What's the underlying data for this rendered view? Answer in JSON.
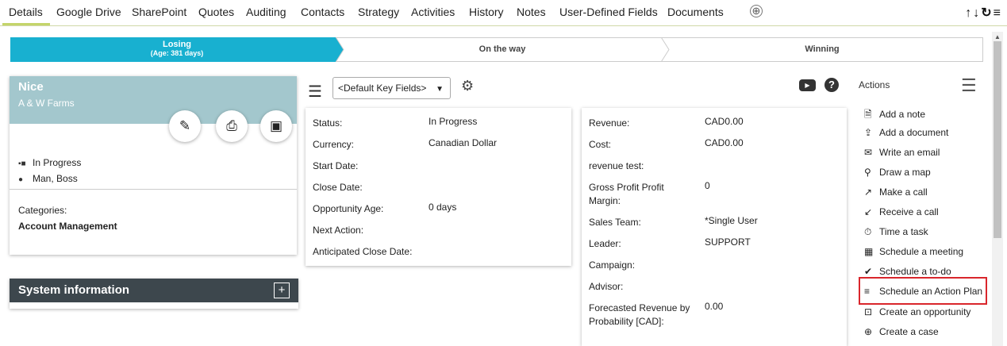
{
  "tabs": {
    "items": [
      "Details",
      "Google Drive",
      "SharePoint",
      "Quotes",
      "Auditing",
      "Contacts",
      "Strategy",
      "Activities",
      "History",
      "Notes",
      "User-Defined Fields",
      "Documents"
    ],
    "add": "⊕"
  },
  "top_icons": "↑↓↻≡",
  "stages": [
    {
      "label": "Losing",
      "sub": "(Age: 381 days)"
    },
    {
      "label": "On the way"
    },
    {
      "label": "Winning"
    }
  ],
  "card": {
    "title": "Nice",
    "subtitle": "A & W Farms",
    "status": "In Progress",
    "owner": "Man, Boss",
    "categories_label": "Categories:",
    "categories_value": "Account Management"
  },
  "system_info": {
    "title": "System information",
    "plus": "+"
  },
  "toolbar": {
    "key_fields": "<Default Key Fields>"
  },
  "panel1": [
    {
      "label": "Status:",
      "value": "In Progress"
    },
    {
      "label": "Currency:",
      "value": "Canadian Dollar"
    },
    {
      "label": "Start Date:",
      "value": ""
    },
    {
      "label": "Close Date:",
      "value": ""
    },
    {
      "label": "Opportunity Age:",
      "value": "0 days"
    },
    {
      "label": "Next Action:",
      "value": ""
    },
    {
      "label": "Anticipated Close Date:",
      "value": ""
    }
  ],
  "panel2": [
    {
      "label": "Revenue:",
      "value": "CAD0.00"
    },
    {
      "label": "Cost:",
      "value": "CAD0.00"
    },
    {
      "label": "revenue test:",
      "value": ""
    },
    {
      "label": "Gross Profit Profit Margin:",
      "value": "0"
    },
    {
      "label": "Sales Team:",
      "value": "*Single User"
    },
    {
      "label": "Leader:",
      "value": "SUPPORT"
    },
    {
      "label": "Campaign:",
      "value": ""
    },
    {
      "label": "Advisor:",
      "value": ""
    },
    {
      "label": "Forecasted Revenue by Probability [CAD]:",
      "value": "0.00"
    }
  ],
  "actions": {
    "title": "Actions",
    "items": [
      {
        "label": "Add a note",
        "icon": "note-icon"
      },
      {
        "label": "Add a document",
        "icon": "upload-icon"
      },
      {
        "label": "Write an email",
        "icon": "envelope-icon"
      },
      {
        "label": "Draw a map",
        "icon": "map-pin-icon"
      },
      {
        "label": "Make a call",
        "icon": "outgoing-call-icon"
      },
      {
        "label": "Receive a call",
        "icon": "incoming-call-icon"
      },
      {
        "label": "Time a task",
        "icon": "stopwatch-icon"
      },
      {
        "label": "Schedule a meeting",
        "icon": "calendar-icon"
      },
      {
        "label": "Schedule a to-do",
        "icon": "check-circle-icon"
      },
      {
        "label": "Schedule an Action Plan",
        "icon": "action-plan-icon"
      },
      {
        "label": "Create an opportunity",
        "icon": "briefcase-icon"
      },
      {
        "label": "Create a case",
        "icon": "lifebuoy-icon"
      }
    ]
  },
  "colors": {
    "active_stage": "#18b0d0",
    "card_header": "#a3c7cd",
    "system_bar": "#3d474d",
    "highlight": "#d9262c",
    "tab_accent": "#c4d46a"
  }
}
